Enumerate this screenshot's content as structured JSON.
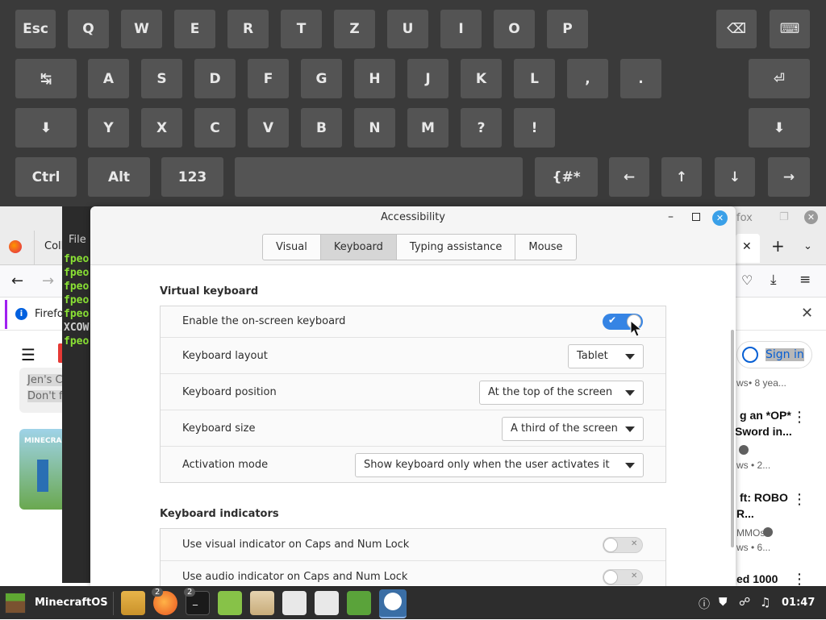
{
  "keyboard": {
    "row1": [
      "Esc",
      "Q",
      "W",
      "E",
      "R",
      "T",
      "Z",
      "U",
      "I",
      "O",
      "P",
      "⌫",
      "⌨"
    ],
    "row2": [
      "↹",
      "A",
      "S",
      "D",
      "F",
      "G",
      "H",
      "J",
      "K",
      "L",
      ",",
      ".",
      "⏎"
    ],
    "row3": [
      "⬇",
      "Y",
      "X",
      "C",
      "V",
      "B",
      "N",
      "M",
      "?",
      "!",
      "⬇"
    ],
    "row4": [
      "Ctrl",
      "Alt",
      "123",
      "",
      "{#*",
      "←",
      "↑",
      "↓",
      "→"
    ]
  },
  "browser": {
    "tab_partial": "Coll",
    "right_title": "fox",
    "info_text": "Firefo",
    "sign_in": "Sign in",
    "meta1": "ws",
    "meta1b": "• 8 yea...",
    "video2_title_a": "g an *OP*",
    "video2_title_b": "Sword in...",
    "video2_meta": "ws • 2...",
    "video3_title_a": "ft: ROBO",
    "video3_title_b": "R...",
    "video3_channel": "MMOs",
    "video3_meta": "ws • 6...",
    "video4_title": "ed 1000",
    "left_card_a": "Jen's C",
    "left_card_b": "Don't f",
    "thumb_label": "MINECRAFT"
  },
  "terminal": {
    "menu": "File",
    "lines": [
      "fpeo",
      "fpeo",
      "fpeo",
      "fpeo",
      "fpeo",
      "XCOW",
      "fpeo"
    ]
  },
  "dialog": {
    "title": "Accessibility",
    "tabs": [
      "Visual",
      "Keyboard",
      "Typing assistance",
      "Mouse"
    ],
    "virtual_keyboard": {
      "heading": "Virtual keyboard",
      "enable_label": "Enable the on-screen keyboard",
      "enable_state": true,
      "layout_label": "Keyboard layout",
      "layout_value": "Tablet",
      "position_label": "Keyboard position",
      "position_value": "At the top of the screen",
      "size_label": "Keyboard size",
      "size_value": "A third of the screen",
      "activation_label": "Activation mode",
      "activation_value": "Show keyboard only when the user activates it"
    },
    "indicators": {
      "heading": "Keyboard indicators",
      "visual_label": "Use visual indicator on Caps and Num Lock",
      "visual_state": false,
      "audio_label": "Use audio indicator on Caps and Num Lock",
      "audio_state": false
    }
  },
  "taskbar": {
    "menu_label": "MinecraftOS",
    "clock": "01:47",
    "badge_firefox": "2",
    "badge_terminal": "2",
    "terminal_glyph": "_"
  },
  "colors": {
    "accent": "#3584e4",
    "keyboard_bg": "#3a3a3a",
    "key_bg": "#545454",
    "terminal_text": "#8ae234",
    "taskbar_bg": "#2d2d2d"
  }
}
